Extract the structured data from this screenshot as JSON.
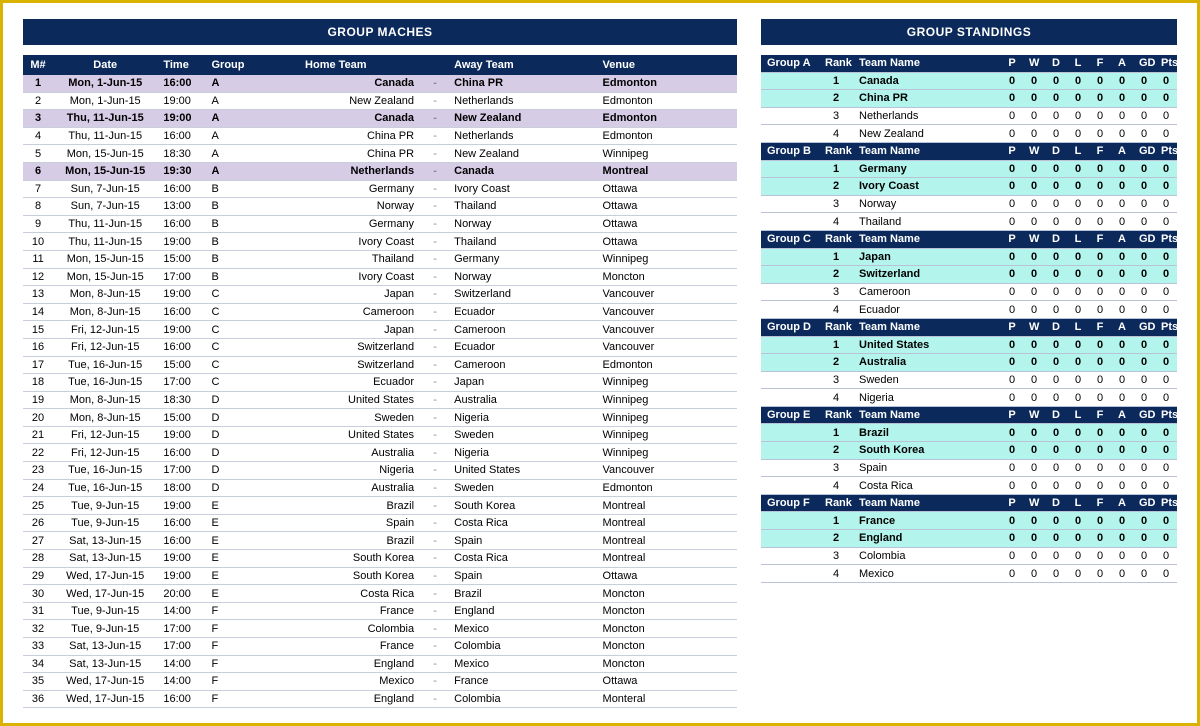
{
  "titles": {
    "matches": "GROUP MACHES",
    "standings": "GROUP STANDINGS"
  },
  "matches": {
    "headers": {
      "m": "M#",
      "date": "Date",
      "time": "Time",
      "group": "Group",
      "home": "Home Team",
      "away": "Away Team",
      "venue": "Venue"
    },
    "rows": [
      {
        "n": 1,
        "date": "Mon, 1-Jun-15",
        "time": "16:00",
        "g": "A",
        "home": "Canada",
        "away": "China PR",
        "venue": "Edmonton",
        "hl": true
      },
      {
        "n": 2,
        "date": "Mon, 1-Jun-15",
        "time": "19:00",
        "g": "A",
        "home": "New Zealand",
        "away": "Netherlands",
        "venue": "Edmonton"
      },
      {
        "n": 3,
        "date": "Thu, 11-Jun-15",
        "time": "19:00",
        "g": "A",
        "home": "Canada",
        "away": "New Zealand",
        "venue": "Edmonton",
        "hl": true
      },
      {
        "n": 4,
        "date": "Thu, 11-Jun-15",
        "time": "16:00",
        "g": "A",
        "home": "China PR",
        "away": "Netherlands",
        "venue": "Edmonton"
      },
      {
        "n": 5,
        "date": "Mon, 15-Jun-15",
        "time": "18:30",
        "g": "A",
        "home": "China PR",
        "away": "New Zealand",
        "venue": "Winnipeg"
      },
      {
        "n": 6,
        "date": "Mon, 15-Jun-15",
        "time": "19:30",
        "g": "A",
        "home": "Netherlands",
        "away": "Canada",
        "venue": "Montreal",
        "hl": true
      },
      {
        "n": 7,
        "date": "Sun, 7-Jun-15",
        "time": "16:00",
        "g": "B",
        "home": "Germany",
        "away": "Ivory Coast",
        "venue": "Ottawa"
      },
      {
        "n": 8,
        "date": "Sun, 7-Jun-15",
        "time": "13:00",
        "g": "B",
        "home": "Norway",
        "away": "Thailand",
        "venue": "Ottawa"
      },
      {
        "n": 9,
        "date": "Thu, 11-Jun-15",
        "time": "16:00",
        "g": "B",
        "home": "Germany",
        "away": "Norway",
        "venue": "Ottawa"
      },
      {
        "n": 10,
        "date": "Thu, 11-Jun-15",
        "time": "19:00",
        "g": "B",
        "home": "Ivory Coast",
        "away": "Thailand",
        "venue": "Ottawa"
      },
      {
        "n": 11,
        "date": "Mon, 15-Jun-15",
        "time": "15:00",
        "g": "B",
        "home": "Thailand",
        "away": "Germany",
        "venue": "Winnipeg"
      },
      {
        "n": 12,
        "date": "Mon, 15-Jun-15",
        "time": "17:00",
        "g": "B",
        "home": "Ivory Coast",
        "away": "Norway",
        "venue": "Moncton"
      },
      {
        "n": 13,
        "date": "Mon, 8-Jun-15",
        "time": "19:00",
        "g": "C",
        "home": "Japan",
        "away": "Switzerland",
        "venue": "Vancouver"
      },
      {
        "n": 14,
        "date": "Mon, 8-Jun-15",
        "time": "16:00",
        "g": "C",
        "home": "Cameroon",
        "away": "Ecuador",
        "venue": "Vancouver"
      },
      {
        "n": 15,
        "date": "Fri, 12-Jun-15",
        "time": "19:00",
        "g": "C",
        "home": "Japan",
        "away": "Cameroon",
        "venue": "Vancouver"
      },
      {
        "n": 16,
        "date": "Fri, 12-Jun-15",
        "time": "16:00",
        "g": "C",
        "home": "Switzerland",
        "away": "Ecuador",
        "venue": "Vancouver"
      },
      {
        "n": 17,
        "date": "Tue, 16-Jun-15",
        "time": "15:00",
        "g": "C",
        "home": "Switzerland",
        "away": "Cameroon",
        "venue": "Edmonton"
      },
      {
        "n": 18,
        "date": "Tue, 16-Jun-15",
        "time": "17:00",
        "g": "C",
        "home": "Ecuador",
        "away": "Japan",
        "venue": "Winnipeg"
      },
      {
        "n": 19,
        "date": "Mon, 8-Jun-15",
        "time": "18:30",
        "g": "D",
        "home": "United States",
        "away": "Australia",
        "venue": "Winnipeg"
      },
      {
        "n": 20,
        "date": "Mon, 8-Jun-15",
        "time": "15:00",
        "g": "D",
        "home": "Sweden",
        "away": "Nigeria",
        "venue": "Winnipeg"
      },
      {
        "n": 21,
        "date": "Fri, 12-Jun-15",
        "time": "19:00",
        "g": "D",
        "home": "United States",
        "away": "Sweden",
        "venue": "Winnipeg"
      },
      {
        "n": 22,
        "date": "Fri, 12-Jun-15",
        "time": "16:00",
        "g": "D",
        "home": "Australia",
        "away": "Nigeria",
        "venue": "Winnipeg"
      },
      {
        "n": 23,
        "date": "Tue, 16-Jun-15",
        "time": "17:00",
        "g": "D",
        "home": "Nigeria",
        "away": "United States",
        "venue": "Vancouver"
      },
      {
        "n": 24,
        "date": "Tue, 16-Jun-15",
        "time": "18:00",
        "g": "D",
        "home": "Australia",
        "away": "Sweden",
        "venue": "Edmonton"
      },
      {
        "n": 25,
        "date": "Tue, 9-Jun-15",
        "time": "19:00",
        "g": "E",
        "home": "Brazil",
        "away": "South Korea",
        "venue": "Montreal"
      },
      {
        "n": 26,
        "date": "Tue, 9-Jun-15",
        "time": "16:00",
        "g": "E",
        "home": "Spain",
        "away": "Costa Rica",
        "venue": "Montreal"
      },
      {
        "n": 27,
        "date": "Sat, 13-Jun-15",
        "time": "16:00",
        "g": "E",
        "home": "Brazil",
        "away": "Spain",
        "venue": "Montreal"
      },
      {
        "n": 28,
        "date": "Sat, 13-Jun-15",
        "time": "19:00",
        "g": "E",
        "home": "South Korea",
        "away": "Costa Rica",
        "venue": "Montreal"
      },
      {
        "n": 29,
        "date": "Wed, 17-Jun-15",
        "time": "19:00",
        "g": "E",
        "home": "South Korea",
        "away": "Spain",
        "venue": "Ottawa"
      },
      {
        "n": 30,
        "date": "Wed, 17-Jun-15",
        "time": "20:00",
        "g": "E",
        "home": "Costa Rica",
        "away": "Brazil",
        "venue": "Moncton"
      },
      {
        "n": 31,
        "date": "Tue, 9-Jun-15",
        "time": "14:00",
        "g": "F",
        "home": "France",
        "away": "England",
        "venue": "Moncton"
      },
      {
        "n": 32,
        "date": "Tue, 9-Jun-15",
        "time": "17:00",
        "g": "F",
        "home": "Colombia",
        "away": "Mexico",
        "venue": "Moncton"
      },
      {
        "n": 33,
        "date": "Sat, 13-Jun-15",
        "time": "17:00",
        "g": "F",
        "home": "France",
        "away": "Colombia",
        "venue": "Moncton"
      },
      {
        "n": 34,
        "date": "Sat, 13-Jun-15",
        "time": "14:00",
        "g": "F",
        "home": "England",
        "away": "Mexico",
        "venue": "Moncton"
      },
      {
        "n": 35,
        "date": "Wed, 17-Jun-15",
        "time": "14:00",
        "g": "F",
        "home": "Mexico",
        "away": "France",
        "venue": "Ottawa"
      },
      {
        "n": 36,
        "date": "Wed, 17-Jun-15",
        "time": "16:00",
        "g": "F",
        "home": "England",
        "away": "Colombia",
        "venue": "Monteral"
      }
    ]
  },
  "standings": {
    "cols": {
      "rank": "Rank",
      "name": "Team Name",
      "P": "P",
      "W": "W",
      "D": "D",
      "L": "L",
      "F": "F",
      "A": "A",
      "GD": "GD",
      "Pts": "Pts"
    },
    "groups": [
      {
        "label": "Group A",
        "teams": [
          {
            "r": 1,
            "name": "Canada"
          },
          {
            "r": 2,
            "name": "China PR"
          },
          {
            "r": 3,
            "name": "Netherlands"
          },
          {
            "r": 4,
            "name": "New Zealand"
          }
        ]
      },
      {
        "label": "Group B",
        "teams": [
          {
            "r": 1,
            "name": "Germany"
          },
          {
            "r": 2,
            "name": "Ivory Coast"
          },
          {
            "r": 3,
            "name": "Norway"
          },
          {
            "r": 4,
            "name": "Thailand"
          }
        ]
      },
      {
        "label": "Group C",
        "teams": [
          {
            "r": 1,
            "name": "Japan"
          },
          {
            "r": 2,
            "name": "Switzerland"
          },
          {
            "r": 3,
            "name": "Cameroon"
          },
          {
            "r": 4,
            "name": "Ecuador"
          }
        ]
      },
      {
        "label": "Group D",
        "teams": [
          {
            "r": 1,
            "name": "United States"
          },
          {
            "r": 2,
            "name": "Australia"
          },
          {
            "r": 3,
            "name": "Sweden"
          },
          {
            "r": 4,
            "name": "Nigeria"
          }
        ]
      },
      {
        "label": "Group E",
        "teams": [
          {
            "r": 1,
            "name": "Brazil"
          },
          {
            "r": 2,
            "name": "South Korea"
          },
          {
            "r": 3,
            "name": "Spain"
          },
          {
            "r": 4,
            "name": "Costa Rica"
          }
        ]
      },
      {
        "label": "Group F",
        "teams": [
          {
            "r": 1,
            "name": "France"
          },
          {
            "r": 2,
            "name": "England"
          },
          {
            "r": 3,
            "name": "Colombia"
          },
          {
            "r": 4,
            "name": "Mexico"
          }
        ]
      }
    ],
    "zero": "0"
  }
}
